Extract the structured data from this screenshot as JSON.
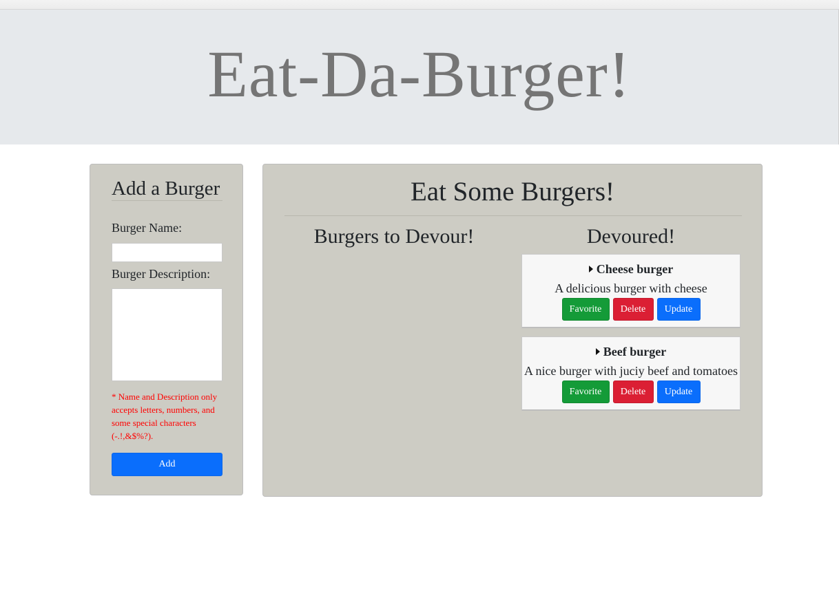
{
  "header": {
    "title": "Eat-Da-Burger!"
  },
  "add_panel": {
    "title": "Add a Burger",
    "name_label": "Burger Name:",
    "name_value": "",
    "description_label": "Burger Description:",
    "description_value": "",
    "note": "* Name and Description only accepts letters, numbers, and some special characters (-.!,&$%?).",
    "add_button": "Add"
  },
  "eat_panel": {
    "title": "Eat Some Burgers!",
    "devour_column_title": "Burgers to Devour!",
    "devoured_column_title": "Devoured!",
    "devoured": [
      {
        "name": "Cheese burger",
        "description": "A delicious burger with cheese",
        "favorite_button": "Favorite",
        "delete_button": "Delete",
        "update_button": "Update"
      },
      {
        "name": "Beef burger",
        "description": "A nice burger with juciy beef and tomatoes",
        "favorite_button": "Favorite",
        "delete_button": "Delete",
        "update_button": "Update"
      }
    ]
  },
  "colors": {
    "jumbotron_bg": "#e6e9ec",
    "panel_bg": "#cdccc4",
    "favorite": "#149b38",
    "delete": "#db1f34",
    "update": "#0a6efc",
    "note": "#ff0000"
  },
  "icons": {
    "caret": "caret-right-icon"
  }
}
